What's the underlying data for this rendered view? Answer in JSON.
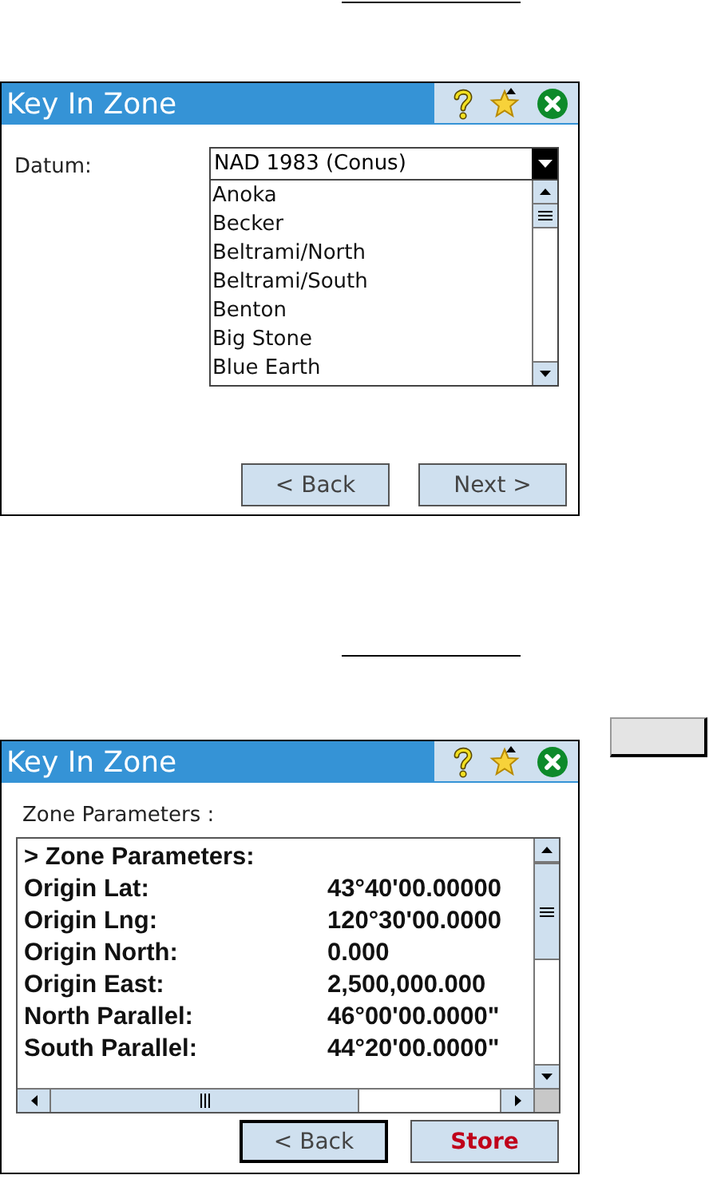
{
  "screens": [
    {
      "title": "Key In Zone",
      "kind": "datum",
      "label": "Datum:",
      "dropdown": {
        "value": "NAD 1983 (Conus)",
        "expanded": true
      },
      "list": [
        "Anoka",
        "Becker",
        "Beltrami/North",
        "Beltrami/South",
        "Benton",
        "Big Stone",
        "Blue Earth"
      ],
      "buttons": [
        {
          "label": "< Back",
          "kind": "normal"
        },
        {
          "label": "Next >",
          "kind": "normal"
        }
      ]
    },
    {
      "title": "Key In Zone",
      "kind": "params",
      "label": "Zone Parameters :",
      "heading": "> Zone Parameters:",
      "rows": [
        {
          "name": "Origin Lat:",
          "value": "43°40'00.00000"
        },
        {
          "name": "Origin Lng:",
          "value": "120°30'00.0000"
        },
        {
          "name": "Origin North:",
          "value": "0.000"
        },
        {
          "name": "Origin East:",
          "value": "2,500,000.000"
        },
        {
          "name": "North Parallel:",
          "value": "46°00'00.0000\""
        },
        {
          "name": "South Parallel:",
          "value": "44°20'00.0000\""
        }
      ],
      "buttons": [
        {
          "label": "< Back",
          "kind": "default"
        },
        {
          "label": "Store",
          "kind": "accent"
        }
      ]
    }
  ]
}
